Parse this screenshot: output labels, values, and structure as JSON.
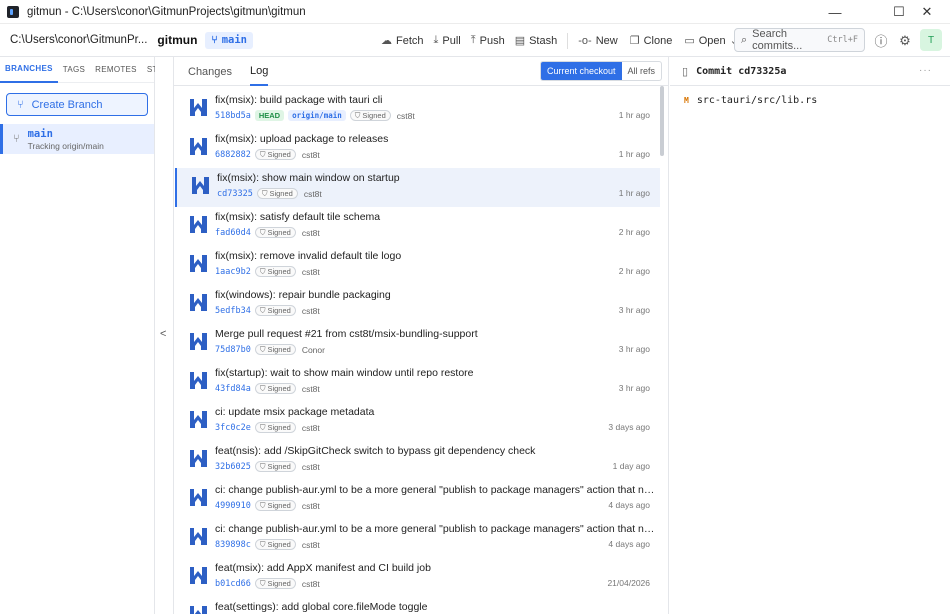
{
  "window": {
    "title": "gitmun - C:\\Users\\conor\\GitmunProjects\\gitmun\\gitmun",
    "minimize": "—",
    "maximize": "☐",
    "close": "✕"
  },
  "toolbar": {
    "path": "C:\\Users\\conor\\GitmunPr...",
    "repo": "gitmun",
    "branch": "main",
    "actions": {
      "fetch": "Fetch",
      "pull": "Pull",
      "push": "Push",
      "stash": "Stash",
      "new": "New",
      "clone": "Clone",
      "open": "Open"
    },
    "search_placeholder": "Search commits...",
    "search_shortcut": "Ctrl+F",
    "avatar": "T"
  },
  "sidebar": {
    "tabs": [
      "BRANCHES",
      "TAGS",
      "REMOTES",
      "STASHES"
    ],
    "create_branch": "Create Branch",
    "branches": [
      {
        "name": "main",
        "tracking": "Tracking origin/main"
      }
    ]
  },
  "main": {
    "tabs": [
      "Changes",
      "Log"
    ],
    "view_modes": [
      "Current checkout",
      "All refs"
    ],
    "commits": [
      {
        "message": "fix(msix): build package with tauri cli",
        "hash": "518bd5a",
        "head": "HEAD",
        "ref": "origin/main",
        "signed": "Signed",
        "author": "cst8t",
        "time": "1 hr ago"
      },
      {
        "message": "fix(msix): upload package to releases",
        "hash": "6882882",
        "signed": "Signed",
        "author": "cst8t",
        "time": "1 hr ago"
      },
      {
        "message": "fix(msix): show main window on startup",
        "hash": "cd73325",
        "signed": "Signed",
        "author": "cst8t",
        "time": "1 hr ago"
      },
      {
        "message": "fix(msix): satisfy default tile schema",
        "hash": "fad60d4",
        "signed": "Signed",
        "author": "cst8t",
        "time": "2 hr ago"
      },
      {
        "message": "fix(msix): remove invalid default tile logo",
        "hash": "1aac9b2",
        "signed": "Signed",
        "author": "cst8t",
        "time": "2 hr ago"
      },
      {
        "message": "fix(windows): repair bundle packaging",
        "hash": "5edfb34",
        "signed": "Signed",
        "author": "cst8t",
        "time": "3 hr ago"
      },
      {
        "message": "Merge pull request #21 from cst8t/msix-bundling-support",
        "hash": "75d87b0",
        "signed": "Signed",
        "author": "Conor",
        "time": "3 hr ago"
      },
      {
        "message": "fix(startup): wait to show main window until repo restore",
        "hash": "43fd84a",
        "signed": "Signed",
        "author": "cst8t",
        "time": "3 hr ago"
      },
      {
        "message": "ci: update msix package metadata",
        "hash": "3fc0c2e",
        "signed": "Signed",
        "author": "cst8t",
        "time": "3 days ago"
      },
      {
        "message": "feat(nsis): add /SkipGitCheck switch to bypass git dependency check",
        "hash": "32b6025",
        "signed": "Signed",
        "author": "cst8t",
        "time": "1 day ago"
      },
      {
        "message": "ci: change publish-aur.yml to be a more general \"publish to package managers\" action that now publi...",
        "hash": "4990910",
        "signed": "Signed",
        "author": "cst8t",
        "time": "4 days ago"
      },
      {
        "message": "ci: change publish-aur.yml to be a more general \"publish to package managers\" action that now publi...",
        "hash": "839898c",
        "signed": "Signed",
        "author": "cst8t",
        "time": "4 days ago"
      },
      {
        "message": "feat(msix): add AppX manifest and CI build job",
        "hash": "b01cd66",
        "signed": "Signed",
        "author": "cst8t",
        "time": "21/04/2026"
      },
      {
        "message": "feat(settings): add global core.fileMode toggle",
        "hash": "",
        "signed": "",
        "author": "",
        "time": ""
      }
    ]
  },
  "detail": {
    "title": "Commit cd73325a",
    "more": "···",
    "files": [
      {
        "status": "M",
        "path": "src-tauri/src/lib.rs"
      }
    ]
  },
  "colors": {
    "accent": "#2f6fe6",
    "selected_row": "#edf2fb",
    "head_badge": "#1f8f47",
    "modified": "#d97706"
  }
}
